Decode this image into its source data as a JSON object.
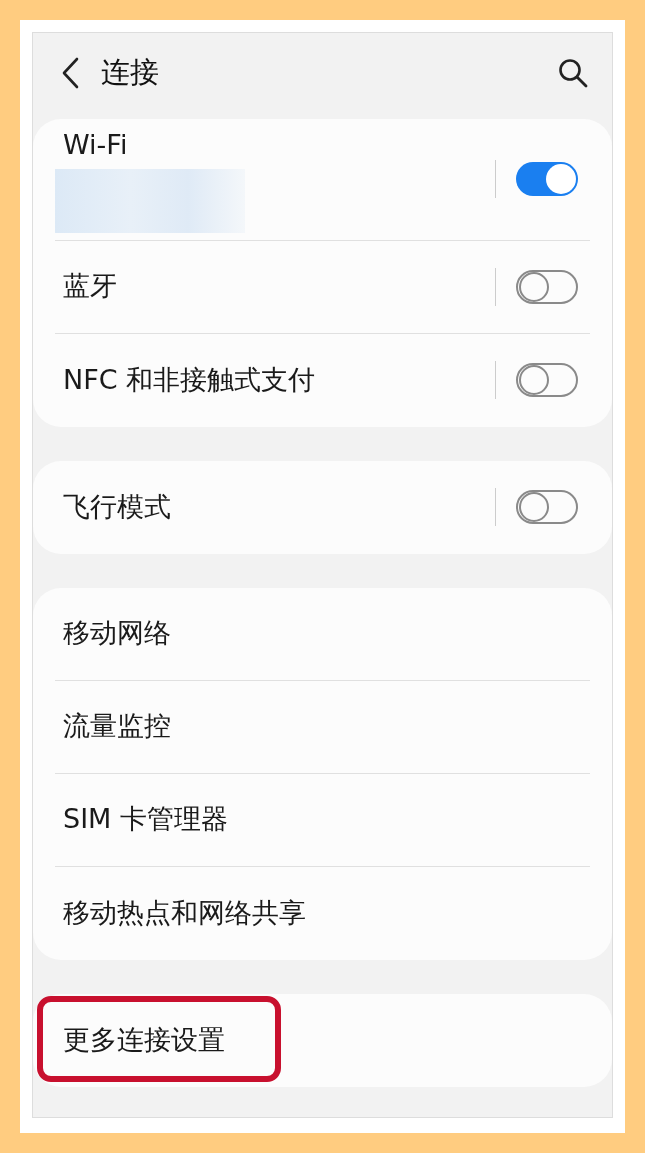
{
  "header": {
    "title": "连接"
  },
  "groups": [
    {
      "items": [
        {
          "kind": "toggle",
          "label": "Wi-Fi",
          "redacted_subtitle": true,
          "on": true,
          "highlighted": false
        },
        {
          "kind": "toggle",
          "label": "蓝牙",
          "on": false,
          "highlighted": false
        },
        {
          "kind": "toggle",
          "label": "NFC 和非接触式支付",
          "on": false,
          "highlighted": false
        }
      ]
    },
    {
      "items": [
        {
          "kind": "toggle",
          "label": "飞行模式",
          "on": false,
          "highlighted": false
        }
      ]
    },
    {
      "items": [
        {
          "kind": "link",
          "label": "移动网络",
          "highlighted": false
        },
        {
          "kind": "link",
          "label": "流量监控",
          "highlighted": false
        },
        {
          "kind": "link",
          "label": "SIM 卡管理器",
          "highlighted": false
        },
        {
          "kind": "link",
          "label": "移动热点和网络共享",
          "highlighted": false
        }
      ]
    },
    {
      "items": [
        {
          "kind": "link",
          "label": "更多连接设置",
          "highlighted": true
        }
      ]
    }
  ]
}
